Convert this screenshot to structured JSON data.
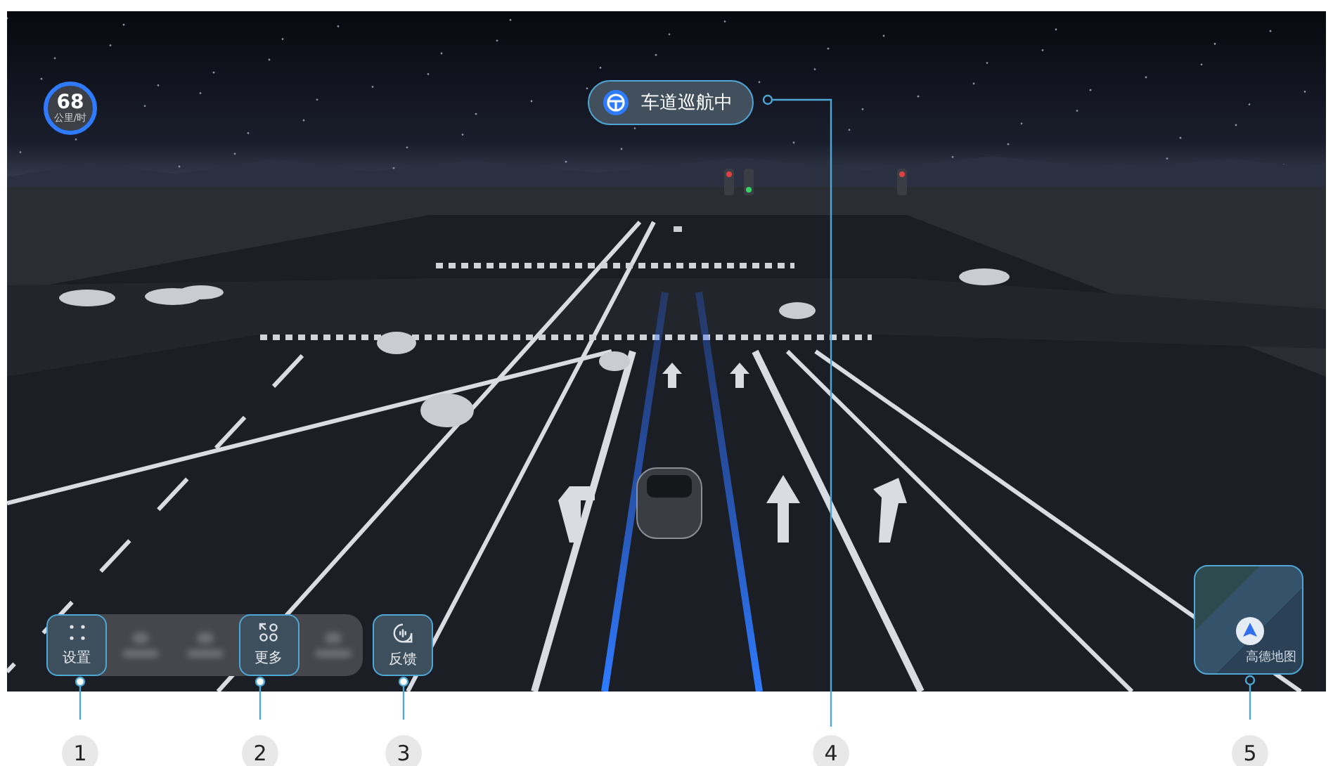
{
  "speed": {
    "value": "68",
    "unit": "公里/时"
  },
  "status_pill": {
    "label": "车道巡航中"
  },
  "toolbar": {
    "items": [
      {
        "kind": "settings",
        "label": "设置"
      },
      {
        "kind": "blurred"
      },
      {
        "kind": "blurred"
      },
      {
        "kind": "more",
        "label": "更多"
      },
      {
        "kind": "blurred"
      }
    ]
  },
  "feedback_button": {
    "label": "反馈"
  },
  "map_widget": {
    "label": "高德地图"
  },
  "callouts": [
    "1",
    "2",
    "3",
    "4",
    "5"
  ]
}
